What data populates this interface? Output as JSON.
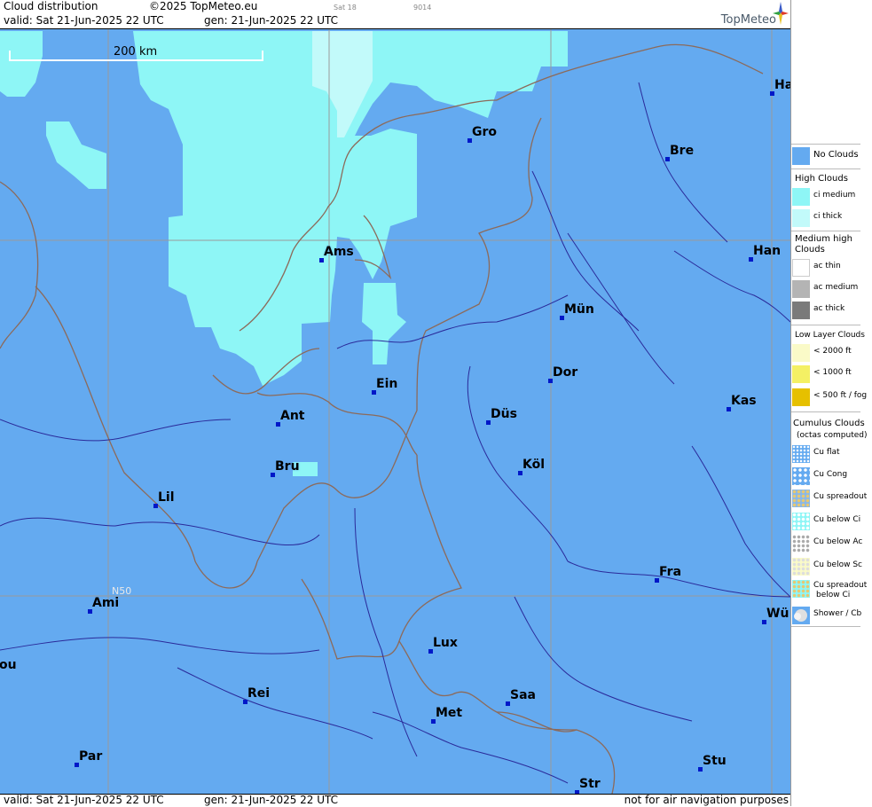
{
  "header": {
    "title": "Cloud distribution",
    "copyright": "©2025 TopMeteo.eu",
    "run_tag": "Sat 18",
    "code": "9014",
    "valid": "valid:  Sat  21-Jun-2025  22 UTC",
    "gen": "gen: 21-Jun-2025 22 UTC",
    "logo": "TopMeteo"
  },
  "footer": {
    "valid": "valid:  Sat  21-Jun-2025  22 UTC",
    "gen": "gen: 21-Jun-2025 22 UTC",
    "notice": "not for air navigation purposes"
  },
  "map": {
    "scale_label": "200 km",
    "lat_label": "N50",
    "colors": {
      "background": "#64aaf0",
      "ci_medium": "#8ef6f6",
      "ci_thick": "#c2fafa",
      "border": "#8c6a5a",
      "river": "#2a2a9a",
      "grid": "#9a9a9a"
    },
    "cities": [
      {
        "name": "Ha"
      },
      {
        "name": "Gro"
      },
      {
        "name": "Bre"
      },
      {
        "name": "Ams"
      },
      {
        "name": "Han"
      },
      {
        "name": "Mün"
      },
      {
        "name": "Dor"
      },
      {
        "name": "Ein"
      },
      {
        "name": "Kas"
      },
      {
        "name": "Ant"
      },
      {
        "name": "Düs"
      },
      {
        "name": "Köl"
      },
      {
        "name": "Bru"
      },
      {
        "name": "Lil"
      },
      {
        "name": "Fra"
      },
      {
        "name": "Ami"
      },
      {
        "name": "Wü"
      },
      {
        "name": "Lux"
      },
      {
        "name": "ou"
      },
      {
        "name": "Rei"
      },
      {
        "name": "Saa"
      },
      {
        "name": "Met"
      },
      {
        "name": "Par"
      },
      {
        "name": "Stu"
      },
      {
        "name": "Str"
      }
    ]
  },
  "legend": {
    "no_clouds": "No Clouds",
    "high_head": "High Clouds",
    "ci_medium": "ci medium",
    "ci_thick": "ci thick",
    "medium_head": "Medium high Clouds",
    "ac_thin": "ac thin",
    "ac_medium": "ac medium",
    "ac_thick": "ac thick",
    "low_head": "Low Layer Clouds",
    "low_2000": "< 2000 ft",
    "low_1000": "< 1000 ft",
    "low_500": "< 500 ft / fog",
    "cu_head": "Cumulus Clouds",
    "cu_sub": "(octas computed)",
    "cu_flat": "Cu flat",
    "cu_cong": "Cu Cong",
    "cu_spread": "Cu spreadout",
    "cu_below_ci": "Cu below Ci",
    "cu_below_ac": "Cu below Ac",
    "cu_below_sc": "Cu below Sc",
    "cu_spread_ci_1": "Cu spreadout",
    "cu_spread_ci_2": "below Ci",
    "shower": "Shower / Cb"
  }
}
